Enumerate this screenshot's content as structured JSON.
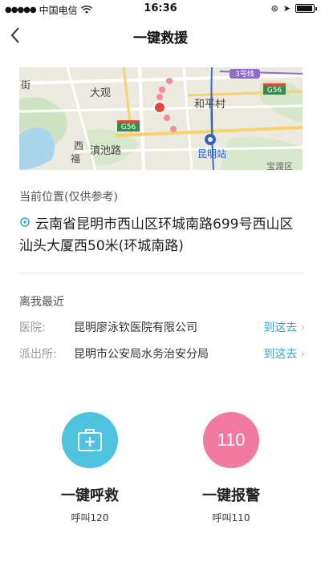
{
  "status_bar": {
    "carrier": "中国电信",
    "time": "16:36"
  },
  "nav": {
    "title": "一键救援"
  },
  "map": {
    "labels": {
      "road_3": "3号线",
      "g56_right": "G56",
      "g56_mid": "G56",
      "daguan": "大观",
      "heping": "和平村",
      "dianchi": "滇池路",
      "kunming_station": "昆明站",
      "xi": "西",
      "fu": "福",
      "jie": "街",
      "anjiang": "宝渡区"
    }
  },
  "location": {
    "label": "当前位置(仅供参考)",
    "address": "云南省昆明市西山区环城南路699号西山区汕头大厦西50米(环城南路)"
  },
  "nearby": {
    "title": "离我最近",
    "rows": [
      {
        "key": "医院:",
        "value": "昆明廖泳钦医院有限公司",
        "go": "到这去"
      },
      {
        "key": "派出所:",
        "value": "昆明市公安局水务治安分局",
        "go": "到这去"
      }
    ]
  },
  "actions": {
    "rescue": {
      "title": "一键呼救",
      "sub": "呼叫120",
      "color": "#4ec3e0"
    },
    "police": {
      "title": "一键报警",
      "sub": "呼叫110",
      "number": "110",
      "color": "#f27aa0"
    }
  }
}
